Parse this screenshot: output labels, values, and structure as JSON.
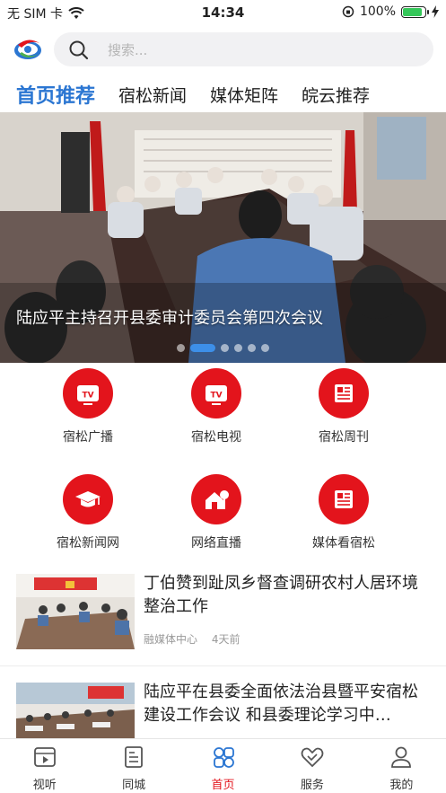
{
  "status_bar": {
    "carrier": "无 SIM 卡",
    "time": "14:34",
    "battery": "100%"
  },
  "header": {
    "search_placeholder": "搜索..."
  },
  "tabs": [
    {
      "label": "首页推荐",
      "active": true
    },
    {
      "label": "宿松新闻",
      "active": false
    },
    {
      "label": "媒体矩阵",
      "active": false
    },
    {
      "label": "皖云推荐",
      "active": false
    }
  ],
  "banner": {
    "caption": "陆应平主持召开县委审计委员会第四次会议",
    "slide_count": 6,
    "active_slide": 1
  },
  "grid": [
    {
      "label": "宿松广播",
      "icon": "tv-icon"
    },
    {
      "label": "宿松电视",
      "icon": "tv-icon"
    },
    {
      "label": "宿松周刊",
      "icon": "newspaper-icon"
    },
    {
      "label": "宿松新闻网",
      "icon": "graduation-cap-icon"
    },
    {
      "label": "网络直播",
      "icon": "house-icon"
    },
    {
      "label": "媒体看宿松",
      "icon": "newspaper-icon"
    }
  ],
  "news": [
    {
      "title": "丁伯赞到趾凤乡督查调研农村人居环境整治工作",
      "source": "融媒体中心",
      "time": "4天前"
    },
    {
      "title": "陆应平在县委全面依法治县暨平安宿松建设工作会议 和县委理论学习中…",
      "source": "",
      "time": ""
    }
  ],
  "bottom_nav": [
    {
      "label": "视听",
      "icon": "video-icon",
      "active": false
    },
    {
      "label": "同城",
      "icon": "document-icon",
      "active": false
    },
    {
      "label": "首页",
      "icon": "home-grid-icon",
      "active": true
    },
    {
      "label": "服务",
      "icon": "handshake-icon",
      "active": false
    },
    {
      "label": "我的",
      "icon": "user-icon",
      "active": false
    }
  ],
  "colors": {
    "accent_blue": "#2b76d2",
    "accent_red": "#e3141c"
  }
}
